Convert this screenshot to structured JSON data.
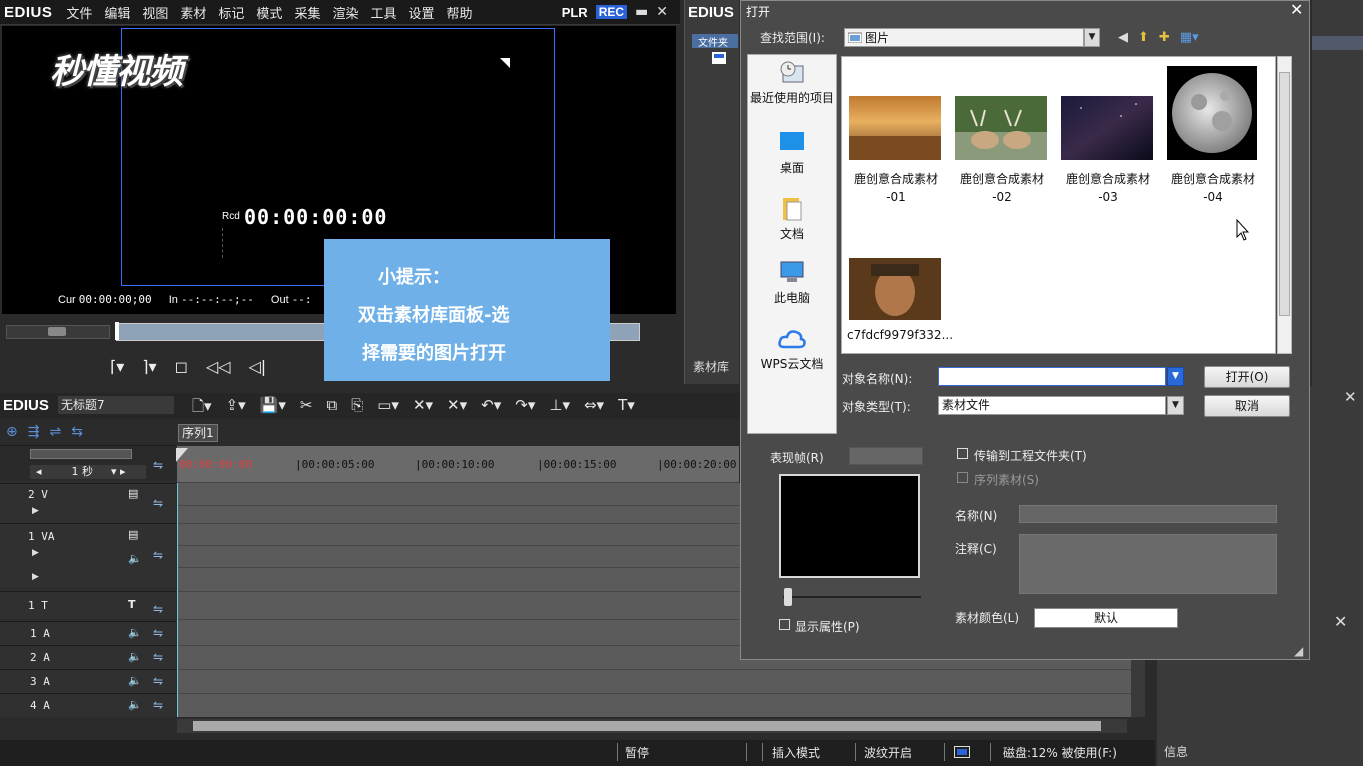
{
  "app": {
    "logo": "EDIUS",
    "menu": [
      "文件",
      "编辑",
      "视图",
      "素材",
      "标记",
      "模式",
      "采集",
      "渲染",
      "工具",
      "设置",
      "帮助"
    ],
    "plr": "PLR",
    "rec": "REC"
  },
  "preview": {
    "watermark": "秒懂视频",
    "timecode_label": "Rcd",
    "timecode": "00:00:00:00",
    "cur_label": "Cur",
    "cur_value": "00:00:00;00",
    "in_label": "In",
    "in_value": "--:--:--;--",
    "out_label": "Out",
    "out_value": "--:"
  },
  "tip": {
    "title": "小提示：",
    "line1": "双击素材库面板-选",
    "line2": "择需要的图片打开"
  },
  "bin": {
    "logo": "EDIUS",
    "folder_label": "文件夹",
    "panel_label": "素材库"
  },
  "timeline": {
    "logo": "EDIUS",
    "project_name": "无标题7",
    "sequence_tab": "序列1",
    "scale": "1 秒",
    "ruler_first": "00:00:00:00",
    "ruler_ticks": [
      "|00:00:05:00",
      "|00:00:10:00",
      "|00:00:15:00",
      "|00:00:20:00"
    ],
    "tracks": [
      "2 V",
      "1 VA",
      "1 T",
      "1 A",
      "2 A",
      "3 A",
      "4 A"
    ]
  },
  "statusbar": {
    "pause": "暂停",
    "insert_mode": "插入模式",
    "ripple": "波纹开启",
    "disk": "磁盘:12% 被使用(F:)"
  },
  "info": {
    "label": "信息"
  },
  "dialog": {
    "title": "打开",
    "lookin_label": "查找范围(I):",
    "lookin_value": "图片",
    "places": [
      "最近使用的项目",
      "桌面",
      "文档",
      "此电脑",
      "WPS云文档"
    ],
    "files": [
      {
        "line1": "鹿创意合成素材",
        "line2": "-01"
      },
      {
        "line1": "鹿创意合成素材",
        "line2": "-02"
      },
      {
        "line1": "鹿创意合成素材",
        "line2": "-03"
      },
      {
        "line1": "鹿创意合成素材",
        "line2": "-04"
      },
      {
        "line1": "c7fdcf9979f332...",
        "line2": ""
      }
    ],
    "object_name_label": "对象名称(N):",
    "object_name_value": "",
    "object_type_label": "对象类型(T):",
    "object_type_value": "素材文件",
    "open_button": "打开(O)",
    "cancel_button": "取消",
    "frame_label": "表现帧(R)",
    "show_props": "显示属性(P)",
    "transfer_to_project": "传输到工程文件夹(T)",
    "sequence_clip": "序列素材(S)",
    "name_label": "名称(N)",
    "note_label": "注释(C)",
    "clip_color_label": "素材颜色(L)",
    "clip_color_value": "默认"
  },
  "colors": {
    "tip_bg": "#6fb0e8",
    "safe_frame": "#3a6fff",
    "rec_badge": "#2a63d8"
  }
}
